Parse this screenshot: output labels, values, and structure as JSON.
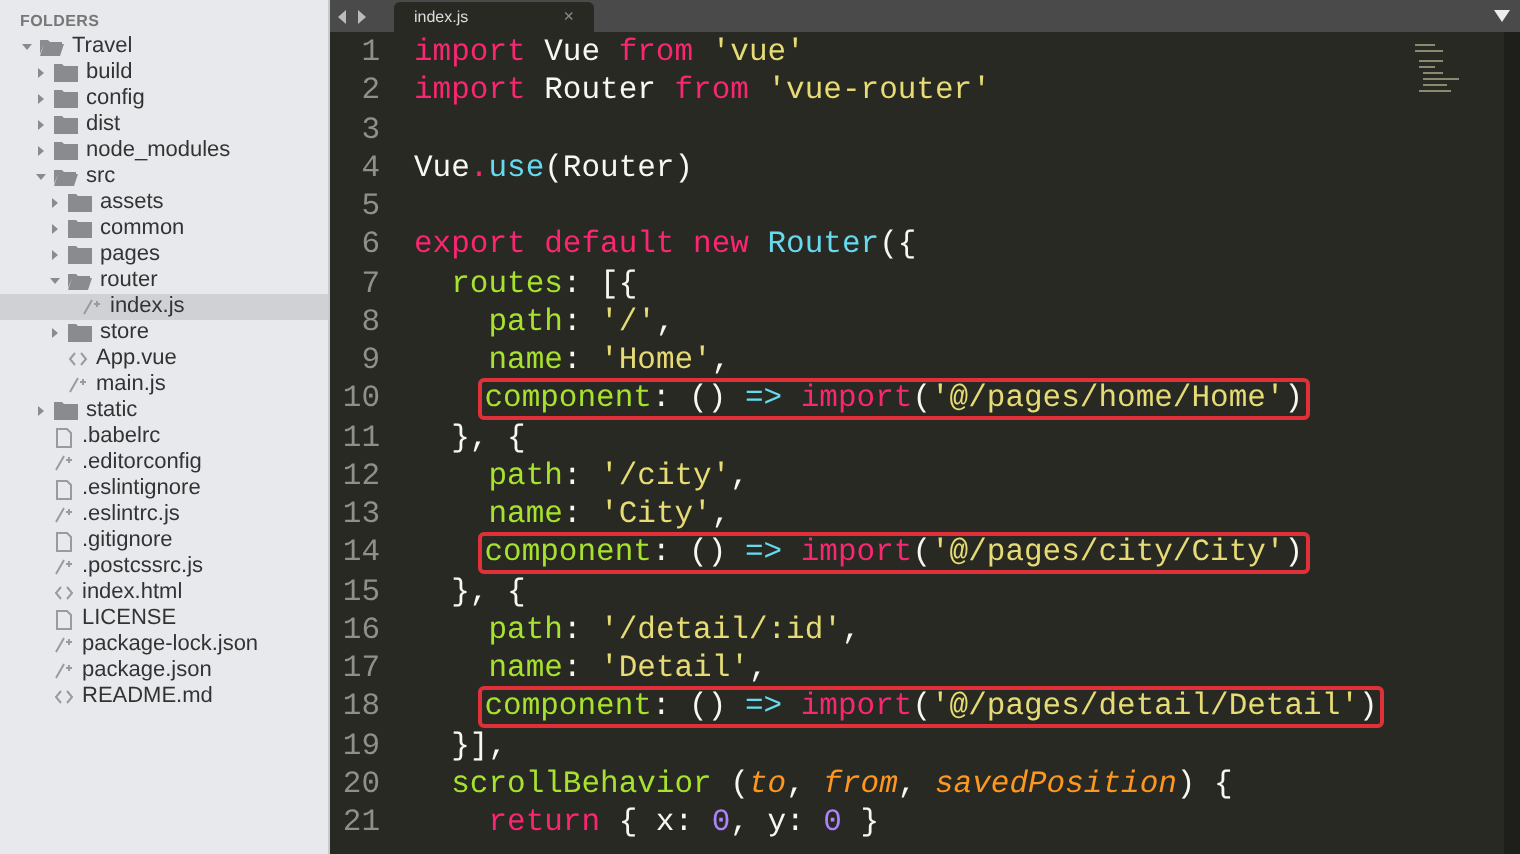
{
  "sidebar": {
    "header": "FOLDERS",
    "tree": [
      {
        "name": "Travel",
        "kind": "folder",
        "expanded": true,
        "selected": false,
        "children": [
          {
            "name": "build",
            "kind": "folder",
            "expanded": false,
            "selected": false
          },
          {
            "name": "config",
            "kind": "folder",
            "expanded": false,
            "selected": false
          },
          {
            "name": "dist",
            "kind": "folder",
            "expanded": false,
            "selected": false
          },
          {
            "name": "node_modules",
            "kind": "folder",
            "expanded": false,
            "selected": false
          },
          {
            "name": "src",
            "kind": "folder",
            "expanded": true,
            "selected": false,
            "children": [
              {
                "name": "assets",
                "kind": "folder",
                "expanded": false,
                "selected": false
              },
              {
                "name": "common",
                "kind": "folder",
                "expanded": false,
                "selected": false
              },
              {
                "name": "pages",
                "kind": "folder",
                "expanded": false,
                "selected": false
              },
              {
                "name": "router",
                "kind": "folder",
                "expanded": true,
                "selected": false,
                "children": [
                  {
                    "name": "index.js",
                    "kind": "script",
                    "selected": true
                  }
                ]
              },
              {
                "name": "store",
                "kind": "folder",
                "expanded": false,
                "selected": false
              },
              {
                "name": "App.vue",
                "kind": "markup",
                "selected": false
              },
              {
                "name": "main.js",
                "kind": "script",
                "selected": false
              }
            ]
          },
          {
            "name": "static",
            "kind": "folder",
            "expanded": false,
            "selected": false
          },
          {
            "name": ".babelrc",
            "kind": "plain",
            "selected": false
          },
          {
            "name": ".editorconfig",
            "kind": "script",
            "selected": false
          },
          {
            "name": ".eslintignore",
            "kind": "plain",
            "selected": false
          },
          {
            "name": ".eslintrc.js",
            "kind": "script",
            "selected": false
          },
          {
            "name": ".gitignore",
            "kind": "plain",
            "selected": false
          },
          {
            "name": ".postcssrc.js",
            "kind": "script",
            "selected": false
          },
          {
            "name": "index.html",
            "kind": "markup",
            "selected": false
          },
          {
            "name": "LICENSE",
            "kind": "plain",
            "selected": false
          },
          {
            "name": "package-lock.json",
            "kind": "script",
            "selected": false
          },
          {
            "name": "package.json",
            "kind": "script",
            "selected": false
          },
          {
            "name": "README.md",
            "kind": "markup",
            "selected": false
          }
        ]
      }
    ]
  },
  "tabs": [
    {
      "label": "index.js",
      "close": "×",
      "selected": true
    }
  ],
  "editor": {
    "lines": [
      {
        "number": "1",
        "boxed": false,
        "tokens": [
          {
            "kind": "keyword",
            "text": "import"
          },
          {
            "kind": "plain",
            "text": " Vue "
          },
          {
            "kind": "keyword",
            "text": "from"
          },
          {
            "kind": "string",
            "text": " 'vue'"
          }
        ]
      },
      {
        "number": "2",
        "boxed": false,
        "tokens": [
          {
            "kind": "keyword",
            "text": "import"
          },
          {
            "kind": "plain",
            "text": " Router "
          },
          {
            "kind": "keyword",
            "text": "from"
          },
          {
            "kind": "string",
            "text": " 'vue-router'"
          }
        ]
      },
      {
        "number": "3"
      },
      {
        "number": "4",
        "boxed": false,
        "tokens": [
          {
            "kind": "plain",
            "text": "Vue"
          },
          {
            "kind": "keyword",
            "text": "."
          },
          {
            "kind": "func",
            "text": "use"
          },
          {
            "kind": "plain",
            "text": "(Router)"
          }
        ]
      },
      {
        "number": "5"
      },
      {
        "number": "6",
        "boxed": false,
        "tokens": [
          {
            "kind": "keyword",
            "text": "export default new"
          },
          {
            "kind": "func",
            "text": " Router"
          },
          {
            "kind": "plain",
            "text": "({"
          }
        ]
      },
      {
        "number": "7",
        "boxed": false,
        "tokens": [
          {
            "kind": "key",
            "text": "  routes"
          },
          {
            "kind": "plain",
            "text": ": [{"
          }
        ]
      },
      {
        "number": "8",
        "boxed": false,
        "tokens": [
          {
            "kind": "key",
            "text": "    path"
          },
          {
            "kind": "plain",
            "text": ": "
          },
          {
            "kind": "string",
            "text": "'/'"
          },
          {
            "kind": "plain",
            "text": ","
          }
        ]
      },
      {
        "number": "9",
        "boxed": false,
        "tokens": [
          {
            "kind": "key",
            "text": "    name"
          },
          {
            "kind": "plain",
            "text": ": "
          },
          {
            "kind": "string",
            "text": "'Home'"
          },
          {
            "kind": "plain",
            "text": ","
          }
        ]
      },
      {
        "number": "10",
        "boxed": true,
        "tokens": [
          {
            "kind": "key",
            "text": "    component"
          },
          {
            "kind": "plain",
            "text": ": () "
          },
          {
            "kind": "func",
            "text": "=>"
          },
          {
            "kind": "keyword",
            "text": " import"
          },
          {
            "kind": "plain",
            "text": "("
          },
          {
            "kind": "string",
            "text": "'@/pages/home/Home'"
          },
          {
            "kind": "plain",
            "text": ")"
          }
        ]
      },
      {
        "number": "11",
        "boxed": false,
        "tokens": [
          {
            "kind": "plain",
            "text": "  }, {"
          }
        ]
      },
      {
        "number": "12",
        "boxed": false,
        "tokens": [
          {
            "kind": "key",
            "text": "    path"
          },
          {
            "kind": "plain",
            "text": ": "
          },
          {
            "kind": "string",
            "text": "'/city'"
          },
          {
            "kind": "plain",
            "text": ","
          }
        ]
      },
      {
        "number": "13",
        "boxed": false,
        "tokens": [
          {
            "kind": "key",
            "text": "    name"
          },
          {
            "kind": "plain",
            "text": ": "
          },
          {
            "kind": "string",
            "text": "'City'"
          },
          {
            "kind": "plain",
            "text": ","
          }
        ]
      },
      {
        "number": "14",
        "boxed": true,
        "tokens": [
          {
            "kind": "key",
            "text": "    component"
          },
          {
            "kind": "plain",
            "text": ": () "
          },
          {
            "kind": "func",
            "text": "=>"
          },
          {
            "kind": "keyword",
            "text": " import"
          },
          {
            "kind": "plain",
            "text": "("
          },
          {
            "kind": "string",
            "text": "'@/pages/city/City'"
          },
          {
            "kind": "plain",
            "text": ")"
          }
        ]
      },
      {
        "number": "15",
        "boxed": false,
        "tokens": [
          {
            "kind": "plain",
            "text": "  }, {"
          }
        ]
      },
      {
        "number": "16",
        "boxed": false,
        "tokens": [
          {
            "kind": "key",
            "text": "    path"
          },
          {
            "kind": "plain",
            "text": ": "
          },
          {
            "kind": "string",
            "text": "'/detail/:id'"
          },
          {
            "kind": "plain",
            "text": ","
          }
        ]
      },
      {
        "number": "17",
        "boxed": false,
        "tokens": [
          {
            "kind": "key",
            "text": "    name"
          },
          {
            "kind": "plain",
            "text": ": "
          },
          {
            "kind": "string",
            "text": "'Detail'"
          },
          {
            "kind": "plain",
            "text": ","
          }
        ]
      },
      {
        "number": "18",
        "boxed": true,
        "tokens": [
          {
            "kind": "key",
            "text": "    component"
          },
          {
            "kind": "plain",
            "text": ": () "
          },
          {
            "kind": "func",
            "text": "=>"
          },
          {
            "kind": "keyword",
            "text": " import"
          },
          {
            "kind": "plain",
            "text": "("
          },
          {
            "kind": "string",
            "text": "'@/pages/detail/Detail'"
          },
          {
            "kind": "plain",
            "text": ")"
          }
        ]
      },
      {
        "number": "19",
        "boxed": false,
        "tokens": [
          {
            "kind": "plain",
            "text": "  }],"
          }
        ]
      },
      {
        "number": "20",
        "boxed": false,
        "tokens": [
          {
            "kind": "key",
            "text": "  scrollBehavior"
          },
          {
            "kind": "plain",
            "text": " ("
          },
          {
            "kind": "param",
            "text": "to"
          },
          {
            "kind": "plain",
            "text": ", "
          },
          {
            "kind": "param",
            "text": "from"
          },
          {
            "kind": "plain",
            "text": ", "
          },
          {
            "kind": "param",
            "text": "savedPosition"
          },
          {
            "kind": "plain",
            "text": ") {"
          }
        ]
      },
      {
        "number": "21",
        "boxed": false,
        "tokens": [
          {
            "kind": "keyword",
            "text": "    return"
          },
          {
            "kind": "plain",
            "text": " { x: "
          },
          {
            "kind": "number",
            "text": "0"
          },
          {
            "kind": "plain",
            "text": ", y: "
          },
          {
            "kind": "number",
            "text": "0"
          },
          {
            "kind": "plain",
            "text": " }"
          }
        ]
      }
    ]
  }
}
